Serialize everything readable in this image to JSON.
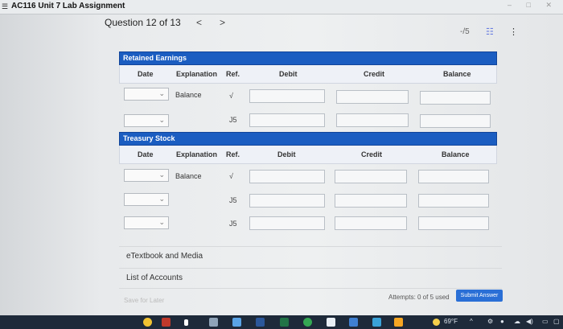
{
  "window": {
    "title": "AC116 Unit 7 Lab Assignment"
  },
  "question": {
    "label": "Question 12 of 13",
    "prev": "<",
    "next": ">",
    "score": "-/5"
  },
  "ledgers": [
    {
      "title": "Retained Earnings",
      "columns": [
        "Date",
        "Explanation",
        "Ref.",
        "Debit",
        "Credit",
        "Balance"
      ],
      "rows": [
        {
          "explanation": "Balance",
          "ref": "√"
        },
        {
          "explanation": "",
          "ref": "J5"
        }
      ]
    },
    {
      "title": "Treasury Stock",
      "columns": [
        "Date",
        "Explanation",
        "Ref.",
        "Debit",
        "Credit",
        "Balance"
      ],
      "rows": [
        {
          "explanation": "Balance",
          "ref": "√"
        },
        {
          "explanation": "",
          "ref": "J5"
        },
        {
          "explanation": "",
          "ref": "J5"
        }
      ]
    }
  ],
  "links": {
    "etextbook": "eTextbook and Media",
    "accounts": "List of Accounts"
  },
  "footer": {
    "save_later": "Save for Later",
    "attempts": "Attempts: 0 of 5 used",
    "submit": "Submit Answer"
  },
  "taskbar": {
    "temperature": "69°F"
  }
}
